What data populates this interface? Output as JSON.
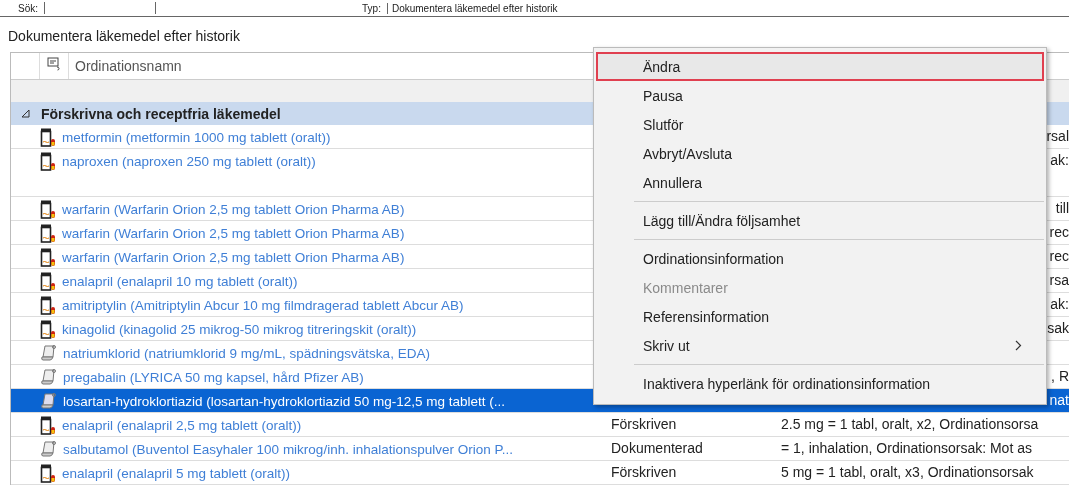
{
  "toolbar": {
    "search_label": "Sök:",
    "type_label": "Typ:",
    "type_value": "Dokumentera läkemedel efter historik"
  },
  "title": "Dokumentera läkemedel efter historik",
  "table": {
    "columns": [
      "Ordinationsnamn"
    ],
    "group": {
      "label": "Förskrivna och receptfria läkemedel",
      "expanded": true,
      "rows": [
        {
          "kind": "bottle",
          "name": "metformin (metformin 1000 mg tablett (oralt))",
          "details_tail": "rsal",
          "selected": false
        },
        {
          "kind": "bottle",
          "name": "naproxen (naproxen 250 mg tablett (oralt))",
          "details_tail": "ak:",
          "tall": true,
          "selected": false
        },
        {
          "kind": "bottle",
          "name": "warfarin (Warfarin Orion 2,5 mg tablett Orion Pharma AB)",
          "details_tail": "till",
          "selected": false
        },
        {
          "kind": "bottle",
          "name": "warfarin (Warfarin Orion 2,5 mg tablett Orion Pharma AB)",
          "details_tail": "rec",
          "selected": false
        },
        {
          "kind": "bottle",
          "name": "warfarin (Warfarin Orion 2,5 mg tablett Orion Pharma AB)",
          "details_tail": "rec",
          "selected": false
        },
        {
          "kind": "bottle",
          "name": "enalapril (enalapril 10 mg tablett (oralt))",
          "details_tail": "rsa",
          "selected": false
        },
        {
          "kind": "bottle",
          "name": "amitriptylin (Amitriptylin Abcur 10 mg filmdragerad tablett Abcur AB)",
          "details_tail": "ak:",
          "selected": false
        },
        {
          "kind": "bottle",
          "name": "kinagolid (kinagolid 25 mikrog-50 mikrog titreringskit (oralt))",
          "details_tail": "sak",
          "selected": false
        },
        {
          "kind": "scroll",
          "name": "natriumklorid (natriumklorid 9 mg/mL, spädningsvätska, EDA)",
          "selected": false
        },
        {
          "kind": "scroll",
          "name": "pregabalin (LYRICA 50 mg kapsel, hård Pfizer AB)",
          "details_tail": ", R",
          "selected": false
        },
        {
          "kind": "scroll",
          "name": "losartan-hydroklortiazid (losartan-hydroklortiazid 50 mg-12,5 mg tablett (...",
          "details_tail": "nat",
          "selected": true
        },
        {
          "kind": "bottle",
          "name": "enalapril (enalapril 2,5 mg tablett (oralt))",
          "status": "Förskriven",
          "details": "2.5 mg = 1 tabl, oralt, x2, Ordinationsorsa",
          "selected": false
        },
        {
          "kind": "scroll",
          "name": "salbutamol (Buventol Easyhaler 100 mikrog/inh. inhalationspulver Orion P...",
          "status": "Dokumenterad",
          "details": "= 1, inhalation, Ordinationsorsak: Mot as",
          "selected": false
        },
        {
          "kind": "bottle",
          "name": "enalapril (enalapril 5 mg tablett (oralt))",
          "status": "Förskriven",
          "details": "5 mg = 1 tabl, oralt, x3, Ordinationsorsak",
          "selected": false
        }
      ]
    }
  },
  "context_menu": {
    "items": [
      {
        "kind": "item",
        "label": "Ändra",
        "selected": true,
        "disabled": false
      },
      {
        "kind": "item",
        "label": "Pausa",
        "selected": false,
        "disabled": false
      },
      {
        "kind": "item",
        "label": "Slutför",
        "selected": false,
        "disabled": false
      },
      {
        "kind": "item",
        "label": "Avbryt/Avsluta",
        "selected": false,
        "disabled": false
      },
      {
        "kind": "item",
        "label": "Annullera",
        "selected": false,
        "disabled": false
      },
      {
        "kind": "separator"
      },
      {
        "kind": "item",
        "label": "Lägg till/Ändra följsamhet",
        "selected": false,
        "disabled": false
      },
      {
        "kind": "separator"
      },
      {
        "kind": "item",
        "label": "Ordinationsinformation",
        "selected": false,
        "disabled": false
      },
      {
        "kind": "item",
        "label": "Kommentarer",
        "selected": false,
        "disabled": true
      },
      {
        "kind": "item",
        "label": "Referensinformation",
        "selected": false,
        "disabled": false
      },
      {
        "kind": "submenu",
        "label": "Skriv ut",
        "selected": false,
        "disabled": false
      },
      {
        "kind": "separator"
      },
      {
        "kind": "item",
        "label": "Inaktivera hyperlänk för ordinationsinformation",
        "selected": false,
        "disabled": false
      }
    ]
  }
}
